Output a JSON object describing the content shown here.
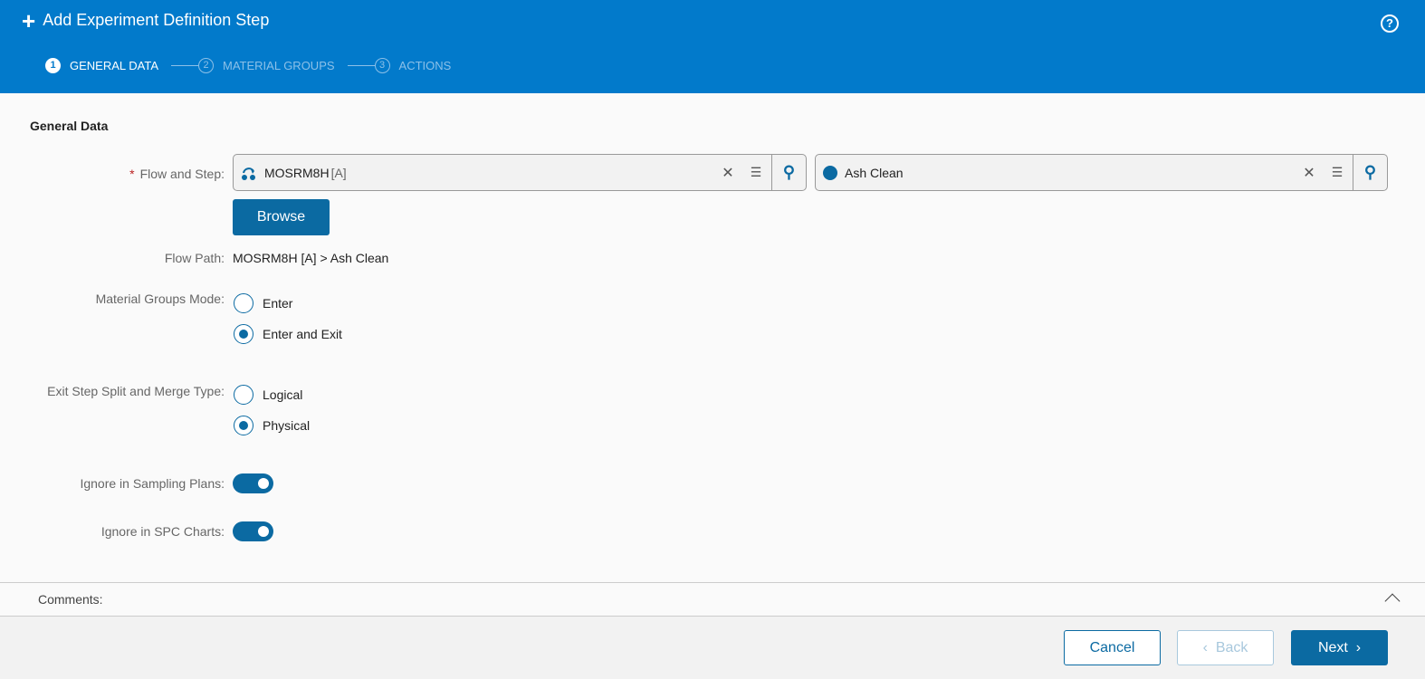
{
  "header": {
    "title": "Add Experiment Definition Step",
    "help": "?",
    "steps": [
      {
        "num": "1",
        "label": "GENERAL DATA"
      },
      {
        "num": "2",
        "label": "MATERIAL GROUPS"
      },
      {
        "num": "3",
        "label": "ACTIONS"
      }
    ]
  },
  "section_title": "General Data",
  "fields": {
    "flow_step_label": "Flow and Step:",
    "flow_value": "MOSRM8H",
    "flow_version": "[A]",
    "step_value": "Ash Clean",
    "browse": "Browse",
    "flow_path_label": "Flow Path:",
    "flow_path_value": "MOSRM8H [A] > Ash Clean",
    "mg_mode_label": "Material Groups Mode:",
    "mg_mode_options": [
      "Enter",
      "Enter and Exit"
    ],
    "mg_mode_selected": "Enter and Exit",
    "split_label": "Exit Step Split and Merge Type:",
    "split_options": [
      "Logical",
      "Physical"
    ],
    "split_selected": "Physical",
    "ignore_sampling_label": "Ignore in Sampling Plans:",
    "ignore_sampling": true,
    "ignore_spc_label": "Ignore in SPC Charts:",
    "ignore_spc": true
  },
  "comments_label": "Comments:",
  "footer": {
    "cancel": "Cancel",
    "back": "Back",
    "next": "Next"
  },
  "colors": {
    "header": "#027acb",
    "primary": "#0b6aa2"
  }
}
